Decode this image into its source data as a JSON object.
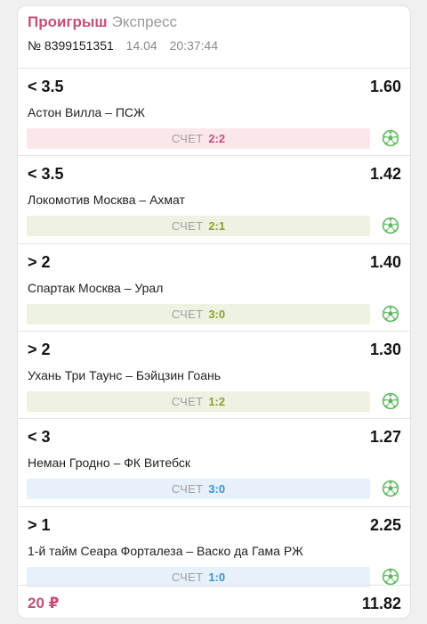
{
  "header": {
    "status": "Проигрыш",
    "type": "Экспресс"
  },
  "meta": {
    "number": "№ 8399151351",
    "date": "14.04",
    "time": "20:37:44"
  },
  "bets": [
    {
      "outcome": "< 3.5",
      "odd": "1.60",
      "match": "Астон Вилла – ПСЖ",
      "score_label": "СЧЕТ",
      "score": "2:2",
      "result": "lost",
      "icon": "soccer-ball-icon"
    },
    {
      "outcome": "< 3.5",
      "odd": "1.42",
      "match": "Локомотив Москва – Ахмат",
      "score_label": "СЧЕТ",
      "score": "2:1",
      "result": "won",
      "icon": "soccer-ball-icon"
    },
    {
      "outcome": "> 2",
      "odd": "1.40",
      "match": "Спартак Москва – Урал",
      "score_label": "СЧЕТ",
      "score": "3:0",
      "result": "won",
      "icon": "soccer-ball-icon"
    },
    {
      "outcome": "> 2",
      "odd": "1.30",
      "match": "Ухань Три Таунс – Бэйцзин Гоань",
      "score_label": "СЧЕТ",
      "score": "1:2",
      "result": "won",
      "icon": "soccer-ball-icon"
    },
    {
      "outcome": "< 3",
      "odd": "1.27",
      "match": "Неман Гродно – ФК Витебск",
      "score_label": "СЧЕТ",
      "score": "3:0",
      "result": "void",
      "icon": "soccer-ball-icon"
    },
    {
      "outcome": "> 1",
      "odd": "2.25",
      "match": "1-й тайм Сеара Форталеза – Васко да Гама РЖ",
      "score_label": "СЧЕТ",
      "score": "1:0",
      "result": "void",
      "icon": "soccer-ball-icon"
    }
  ],
  "footer": {
    "stake": "20 ₽",
    "total_odd": "11.82"
  },
  "colors": {
    "lost": "#c3507a",
    "won": "#8aa032",
    "void": "#3a94d6",
    "ball": "#5cb85c"
  }
}
